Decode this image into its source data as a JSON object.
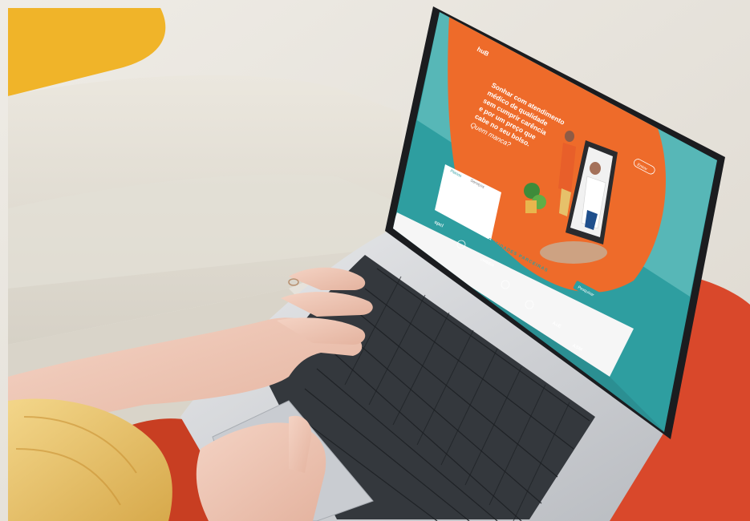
{
  "scene": {
    "description_tags": [
      "laptop",
      "hands-typing",
      "sofa",
      "orange-cushion"
    ]
  },
  "website": {
    "logo_text": "huB",
    "headline_lines": [
      "Sonhar com atendimento",
      "médico de qualidade",
      "sem cumprir carência",
      "e por um preço que",
      "cabe no seu bolso."
    ],
    "headline_cta": "Quem manca?",
    "nav_button": "Entrar",
    "section_title": "ENTIDADES PARCEIRAS",
    "search_button": "Pesquisar",
    "tab_1": "Planos",
    "tab_2": "Serviços"
  },
  "colors": {
    "site_orange": "#ee6b2a",
    "site_teal": "#2e9ea0",
    "cushion_red": "#d9482b",
    "sofa": "#e7e3d9"
  }
}
